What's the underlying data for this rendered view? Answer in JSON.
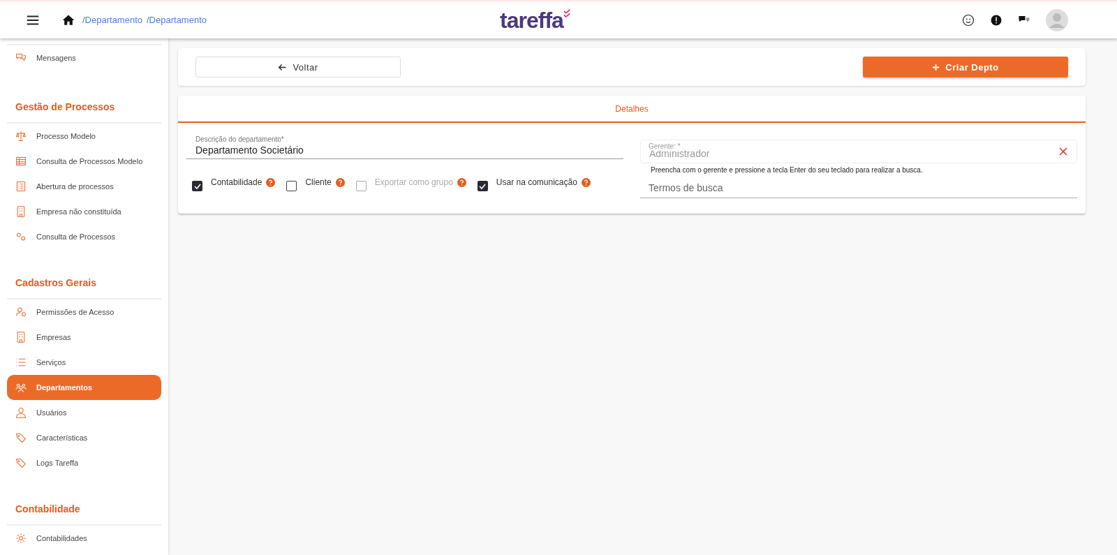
{
  "header": {
    "breadcrumbs": [
      "/Departamento",
      "/Departamento"
    ],
    "logo": "tareffa"
  },
  "sidebar": {
    "sections": [
      {
        "items": [
          {
            "label": "Mensagens",
            "kind": "chat",
            "selected": false
          }
        ]
      },
      {
        "title": "Gestão de Processos",
        "items": [
          {
            "label": "Processo Modelo",
            "kind": "scale",
            "selected": false
          },
          {
            "label": "Consulta de Processos Modelo",
            "kind": "table",
            "selected": false
          },
          {
            "label": "Abertura de processos",
            "kind": "doclist",
            "selected": false
          },
          {
            "label": "Empresa não constituída",
            "kind": "building",
            "selected": false
          },
          {
            "label": "Consulta de Processos",
            "kind": "gears",
            "selected": false
          }
        ]
      },
      {
        "title": "Cadastros Gerais",
        "items": [
          {
            "label": "Permissões de Acesso",
            "kind": "usergear",
            "selected": false
          },
          {
            "label": "Empresas",
            "kind": "building",
            "selected": false
          },
          {
            "label": "Serviços",
            "kind": "list",
            "selected": false
          },
          {
            "label": "Departamentos",
            "kind": "group",
            "selected": true
          },
          {
            "label": "Usuários",
            "kind": "user",
            "selected": false
          },
          {
            "label": "Características",
            "kind": "tag",
            "selected": false
          },
          {
            "label": "Logs Tareffa",
            "kind": "tag",
            "selected": false
          }
        ]
      },
      {
        "title": "Contabilidade",
        "items": [
          {
            "label": "Contabilidades",
            "kind": "gear",
            "selected": false
          }
        ]
      }
    ]
  },
  "toolbar": {
    "back_button": "Voltar",
    "create_button": "Criar Depto"
  },
  "form": {
    "tab": "Detalhes",
    "description": {
      "label": "Descrição do departamento*",
      "value": "Departamento Societário"
    },
    "checkboxes": [
      {
        "label": "Contabilidade",
        "checked": true,
        "disabled": false
      },
      {
        "label": "Cliente",
        "checked": false,
        "disabled": false
      },
      {
        "label": "Exportar como grupo",
        "checked": false,
        "disabled": true
      },
      {
        "label": "Usar na comunicação",
        "checked": true,
        "disabled": false
      }
    ],
    "manager": {
      "label": "Gerente: *",
      "value": "Administrador",
      "disabled": true,
      "hint": "Preencha com o gerente e pressione a tecla Enter do seu teclado para realizar a busca."
    },
    "search": {
      "placeholder": "Termos de busca"
    }
  }
}
